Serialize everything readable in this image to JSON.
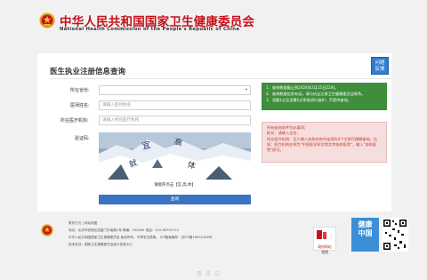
{
  "header": {
    "title_cn": "中华人民共和国国家卫生健康委员会",
    "title_en": "National Health Commission of the People's Republic of China",
    "brand_color": "#c8101b"
  },
  "page": {
    "title": "医生执业注册信息查询",
    "feedback_line1": "问题",
    "feedback_line2": "反馈"
  },
  "form": {
    "province_label": "所在省份:",
    "province_value": "",
    "doctor_name_label": "医师姓名:",
    "doctor_name_placeholder": "请输入医师姓名",
    "institution_label": "所在医疗机构:",
    "institution_placeholder": "请输入所在医疗机构",
    "captcha_label": "验证码:",
    "captcha_chars": [
      "宜",
      "高",
      "就",
      "体"
    ],
    "captcha_hint": "请顺序点击【宜,高,体】",
    "query_button": "查询"
  },
  "notices": {
    "green": [
      "1、查询数据截止到2024年2月15日22时。",
      "2、查询数据信息有误，请与执业注册卫生健康委员会联系。",
      "3、凌晨1点至凌晨5点系统进行维护，不提供查询。"
    ],
    "red_lines": [
      "所有查询条件为必填项;",
      "姓名：请输入全名;",
      "所在医疗机构：至少输入机构名称中连续的4个字即可模糊查询。比如：医疗机构名称为\"中国医学科学院北京协和医院\"，输入\"协和医院\"即可。"
    ]
  },
  "footer": {
    "links": "联系方式 | 网站地图",
    "address": "地址：北京市西城区西直门外南路1号    邮编：100044    电话：010-68792114",
    "copyright": "中华人民共和国国家卫生健康委员会    版权所有，不得非法镜像。    ICP备案编号：京ICP备18052326号",
    "support": "技术支持：国家卫生健康委员会统计信息中心",
    "gov_badge_text": "政府网站",
    "gov_badge_sub": "找错",
    "health_line1": "健康",
    "health_line2": "中国"
  },
  "watermark": "看 寻 记"
}
